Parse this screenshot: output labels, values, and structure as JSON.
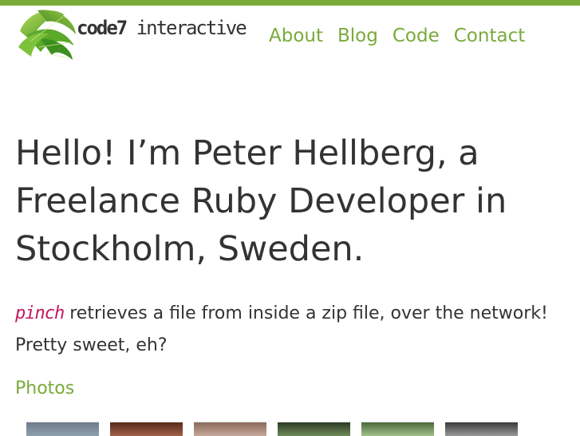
{
  "header": {
    "brand_bold": "code7",
    "brand_rest": " interactive",
    "nav": [
      {
        "label": "About"
      },
      {
        "label": "Blog"
      },
      {
        "label": "Code"
      },
      {
        "label": "Contact"
      }
    ]
  },
  "main": {
    "headline": "Hello! I’m Peter Hellberg, a Freelance Ruby Developer in Stockholm, Sweden.",
    "pitch_project": "pinch",
    "pitch_text": " retrieves a file from inside a zip file, over the network! Pretty sweet, eh?",
    "photos_link": "Photos"
  },
  "colors": {
    "accent": "#7aaa3a",
    "text": "#333333",
    "project": "#c2185b"
  },
  "icons": {
    "logo": "palm-leaf-icon"
  }
}
